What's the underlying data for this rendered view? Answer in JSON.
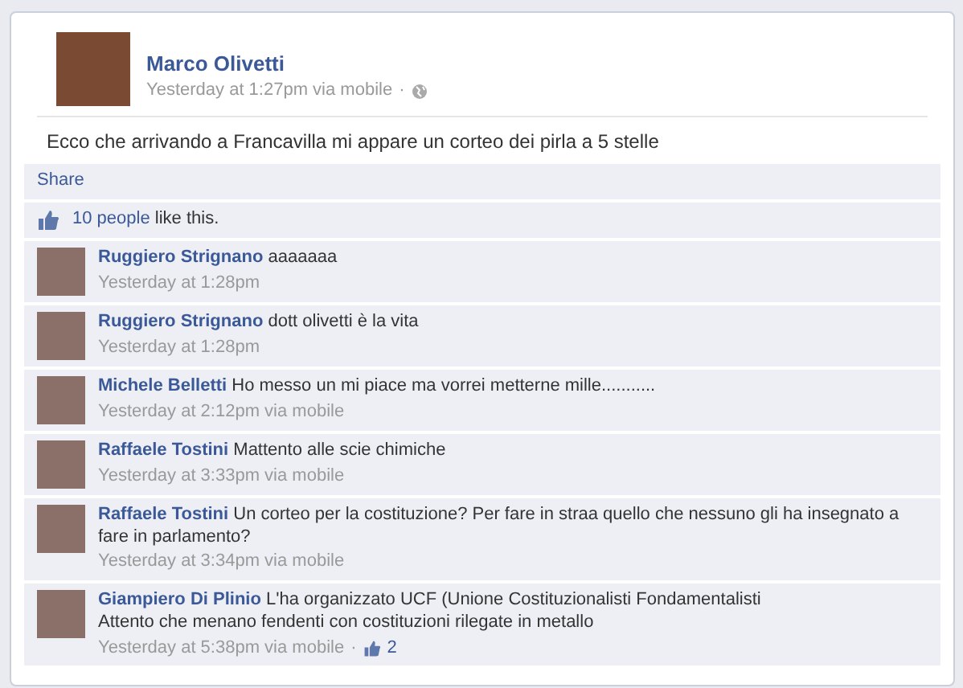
{
  "post": {
    "author": "Marco Olivetti",
    "meta": "Yesterday at 1:27pm via mobile",
    "separator": "·",
    "text": "Ecco che arrivando a Francavilla mi appare un corteo dei pirla a 5 stelle"
  },
  "actions": [
    "Share"
  ],
  "likes": {
    "count_link": "10 people",
    "suffix": "like this."
  },
  "comments": [
    {
      "author": "Ruggiero Strignano",
      "text": "aaaaaaa",
      "meta": "Yesterday at 1:28pm"
    },
    {
      "author": "Ruggiero Strignano",
      "text": "dott olivetti è la vita",
      "meta": "Yesterday at 1:28pm"
    },
    {
      "author": "Michele Belletti",
      "text": "Ho messo un mi piace ma vorrei metterne mille...........",
      "meta": "Yesterday at 2:12pm via mobile"
    },
    {
      "author": "Raffaele Tostini",
      "text": "Mattento alle scie chimiche",
      "meta": "Yesterday at 3:33pm via mobile"
    },
    {
      "author": "Raffaele Tostini",
      "text": "Un corteo per la costituzione? Per fare in straa quello che nessuno gli ha insegnato a fare in parlamento?",
      "meta": "Yesterday at 3:34pm via mobile"
    },
    {
      "author": "Giampiero Di Plinio",
      "text": "L'ha organizzato UCF (Unione Costituzionalisti Fondamentalisti\nAttento che menano fendenti con costituzioni rilegate in metallo",
      "meta": "Yesterday at 5:38pm via mobile",
      "separator": "·",
      "likes": "2"
    }
  ]
}
